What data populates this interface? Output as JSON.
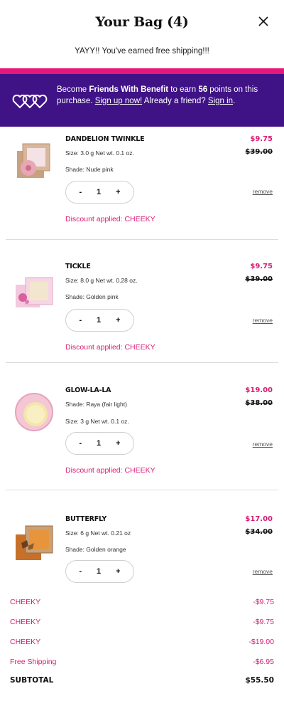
{
  "header": {
    "title": "Your Bag (4)"
  },
  "shipping_message": "YAYY!! You've earned free shipping!!!",
  "promo": {
    "text_pre": "Become ",
    "program": "Friends With Benefit",
    "text_mid": " to earn ",
    "points": "56",
    "text_after": " points on this purchase. ",
    "signup_link": "Sign up now!",
    "text_already": " Already a friend? ",
    "signin_link": "Sign in",
    "text_end": ".",
    "colors": {
      "bar": "#e6177b",
      "background": "#3f1285"
    }
  },
  "items": [
    {
      "name": "DANDELION TWINKLE",
      "line1": "Size: 3.0 g Net wt. 0.1 oz.",
      "line2": "Shade: Nude pink",
      "quantity": "1",
      "price": "$9.75",
      "original_price": "$39.00",
      "discount": "Discount applied: CHEEKY",
      "remove": "remove",
      "minus": "-",
      "plus": "+",
      "icon": "pink-compact-icon"
    },
    {
      "name": "TICKLE",
      "line1": "Size: 8.0 g Net wt. 0.28 oz.",
      "line2": "Shade: Golden pink",
      "quantity": "1",
      "price": "$9.75",
      "original_price": "$39.00",
      "discount": "Discount applied: CHEEKY",
      "remove": "remove",
      "minus": "-",
      "plus": "+",
      "icon": "pink-box-icon"
    },
    {
      "name": "GLOW-LA-LA",
      "line1": "Shade: Raya (fair light)",
      "line2": "Size: 3 g Net wt. 0.1 oz.",
      "quantity": "1",
      "price": "$19.00",
      "original_price": "$38.00",
      "discount": "Discount applied: CHEEKY",
      "remove": "remove",
      "minus": "-",
      "plus": "+",
      "icon": "cushion-compact-icon"
    },
    {
      "name": "BUTTERFLY",
      "line1": "Size: 6 g Net wt. 0.21 oz",
      "line2": "Shade: Golden orange",
      "quantity": "1",
      "price": "$17.00",
      "original_price": "$34.00",
      "remove": "remove",
      "minus": "-",
      "plus": "+",
      "icon": "orange-box-icon"
    }
  ],
  "summary": [
    {
      "label": "CHEEKY",
      "value": "-$9.75"
    },
    {
      "label": "CHEEKY",
      "value": "-$9.75"
    },
    {
      "label": "CHEEKY",
      "value": "-$19.00"
    },
    {
      "label": "Free Shipping",
      "value": "-$6.95"
    }
  ],
  "subtotal": {
    "label": "SUBTOTAL",
    "value": "$55.50"
  },
  "accent_color": "#d81b74"
}
